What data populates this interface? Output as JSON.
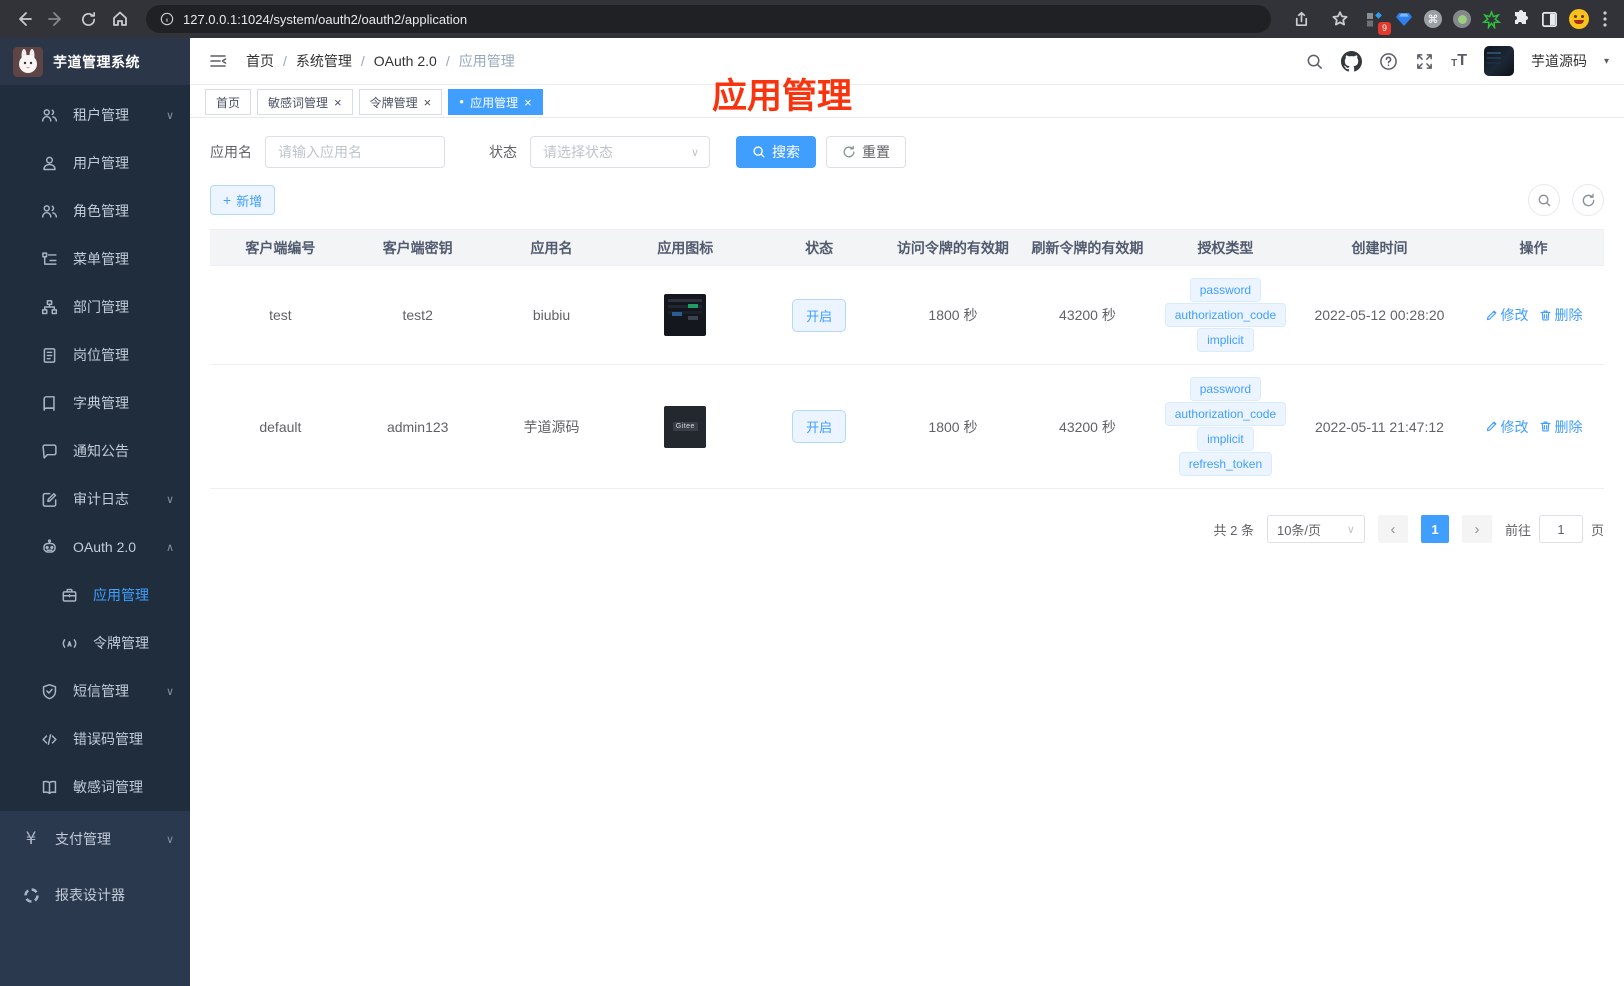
{
  "browser": {
    "url": "127.0.0.1:1024/system/oauth2/oauth2/application",
    "ext_badge": "9"
  },
  "colors": {
    "accent": "#409eff",
    "annotation_red": "#f8340f",
    "sidebar_bg": "#1f2d3d",
    "sidebar_root_bg": "#2a394d",
    "tag_bg": "#ecf5ff",
    "table_header_bg": "#f3f4f6"
  },
  "icons": {
    "close": "×",
    "active_dot": "●",
    "plus": "+",
    "caret_down": "▾",
    "chevron_down": "∨",
    "chevron_up": "∧",
    "chevron_left": "‹",
    "chevron_right": "›",
    "select_arrow": "∨",
    "yen": "¥",
    "breadcrumb_sep": "/",
    "kebab": "⋮"
  },
  "sidebar": {
    "logo_title": "芋道管理系统",
    "menu": [
      {
        "label": "租户管理"
      },
      {
        "label": "用户管理"
      },
      {
        "label": "角色管理"
      },
      {
        "label": "菜单管理"
      },
      {
        "label": "部门管理"
      },
      {
        "label": "岗位管理"
      },
      {
        "label": "字典管理"
      },
      {
        "label": "通知公告"
      },
      {
        "label": "审计日志"
      },
      {
        "label": "OAuth 2.0"
      },
      {
        "label": "应用管理"
      },
      {
        "label": "令牌管理"
      },
      {
        "label": "短信管理"
      },
      {
        "label": "错误码管理"
      },
      {
        "label": "敏感词管理"
      },
      {
        "label": "支付管理"
      },
      {
        "label": "报表设计器"
      }
    ]
  },
  "navbar": {
    "breadcrumbs": [
      "首页",
      "系统管理",
      "OAuth 2.0",
      "应用管理"
    ],
    "username": "芋道源码"
  },
  "annotation": {
    "text": "应用管理"
  },
  "tabs": [
    {
      "label": "首页"
    },
    {
      "label": "敏感词管理"
    },
    {
      "label": "令牌管理"
    },
    {
      "label": "应用管理"
    }
  ],
  "filters": {
    "name_label": "应用名",
    "name_placeholder": "请输入应用名",
    "status_label": "状态",
    "status_placeholder": "请选择状态",
    "search_label": "搜索",
    "reset_label": "重置"
  },
  "toolbar": {
    "add_label": "新增"
  },
  "table": {
    "columns": [
      "客户端编号",
      "客户端密钥",
      "应用名",
      "应用图标",
      "状态",
      "访问令牌的有效期",
      "刷新令牌的有效期",
      "授权类型",
      "创建时间",
      "操作"
    ],
    "rows": [
      {
        "client_id": "test",
        "client_secret": "test2",
        "app_name": "biubiu",
        "icon_text": "",
        "status": "开启",
        "access_token_ttl": "1800 秒",
        "refresh_token_ttl": "43200 秒",
        "grant_types": [
          "password",
          "authorization_code",
          "implicit"
        ],
        "created_at": "2022-05-12 00:28:20"
      },
      {
        "client_id": "default",
        "client_secret": "admin123",
        "app_name": "芋道源码",
        "icon_text": "Gitee",
        "status": "开启",
        "access_token_ttl": "1800 秒",
        "refresh_token_ttl": "43200 秒",
        "grant_types": [
          "password",
          "authorization_code",
          "implicit",
          "refresh_token"
        ],
        "created_at": "2022-05-11 21:47:12"
      }
    ],
    "actions": {
      "edit": "修改",
      "delete": "删除"
    }
  },
  "pagination": {
    "total": "共 2 条",
    "page_size": "10条/页",
    "current_page": "1",
    "goto_label": "前往",
    "goto_value": "1",
    "page_unit": "页"
  }
}
